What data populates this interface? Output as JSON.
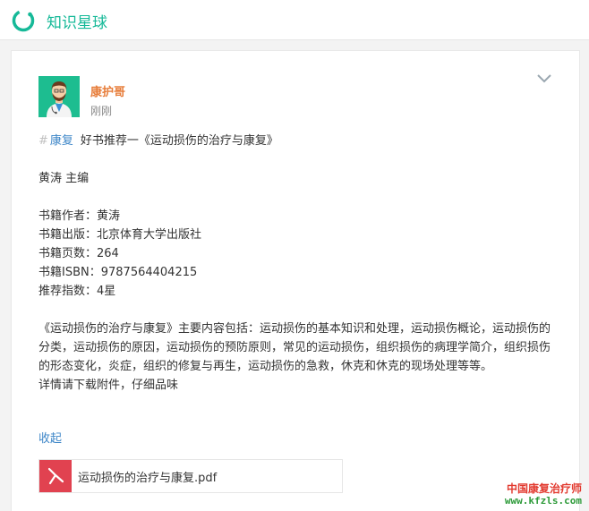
{
  "app": {
    "name": "知识星球",
    "accent": "#16b998"
  },
  "post": {
    "author": "康护哥",
    "time": "刚刚",
    "hashtag_symbol": "#",
    "tag": "康复",
    "title": "好书推荐一《运动损伤的治疗与康复》",
    "editor_line": "黄涛 主编",
    "details": [
      "书籍作者：黄涛",
      "书籍出版：北京体育大学出版社",
      "书籍页数：264",
      "书籍ISBN：9787564404215",
      "推荐指数：4星"
    ],
    "description": "《运动损伤的治疗与康复》主要内容包括：运动损伤的基本知识和处理，运动损伤概论，运动损伤的分类，运动损伤的原因，运动损伤的预防原则，常见的运动损伤，组织损伤的病理学简介，组织损伤的形态变化，炎症，组织的修复与再生，运动损伤的急救，休克和休克的现场处理等等。",
    "closing": "详情请下载附件，仔细品味",
    "collapse_label": "收起",
    "attachment": {
      "filename": "运动损伤的治疗与康复.pdf",
      "icon": "pdf-icon",
      "color": "#e14250"
    }
  },
  "icons": {
    "logo": "planet-logo-icon",
    "menu": "chevron-down-icon"
  },
  "watermark": {
    "line1": "中国康复治疗师",
    "line2": "www.kfzls.com"
  }
}
